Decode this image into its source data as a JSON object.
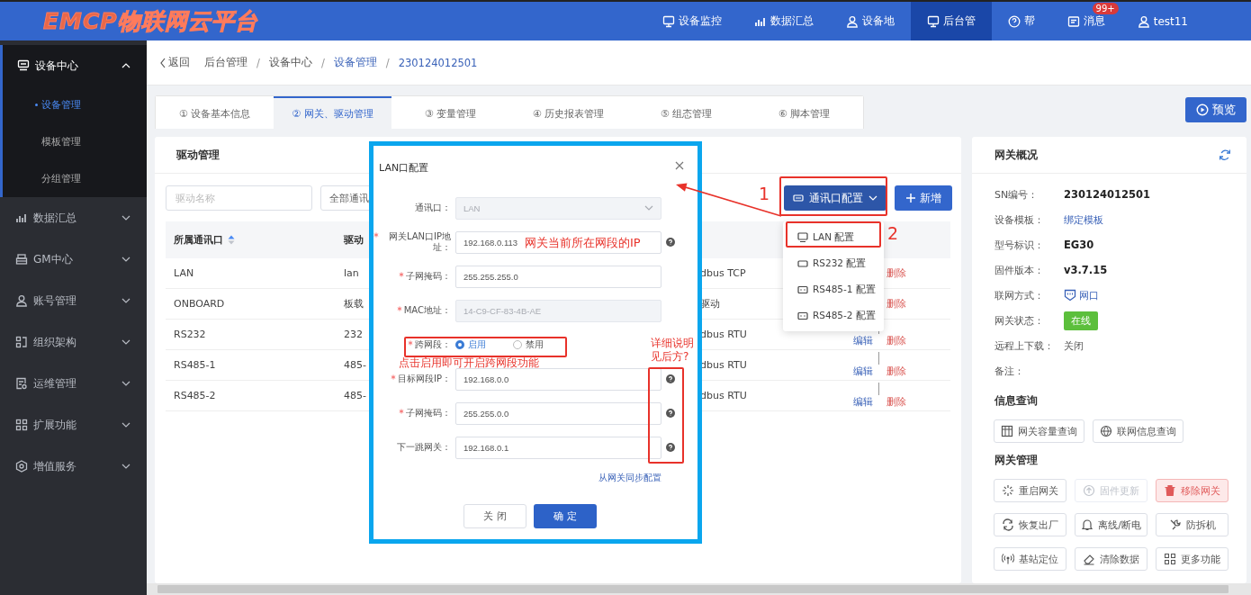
{
  "logo": "EMCP物联网云平台",
  "top_nav": [
    {
      "label": "设备监控",
      "selected": false
    },
    {
      "label": "数据汇总",
      "selected": false
    },
    {
      "label": "设备地",
      "selected": false
    },
    {
      "label": "后台管",
      "selected": true
    },
    {
      "label": "帮",
      "selected": false
    },
    {
      "label": "消息",
      "selected": false,
      "badge": "99+"
    },
    {
      "label": "test11",
      "selected": false
    }
  ],
  "sidebar": {
    "items": [
      {
        "label": "设备中心",
        "expanded": true,
        "children": [
          {
            "label": "设备管理",
            "selected": true
          },
          {
            "label": "模板管理",
            "selected": false
          },
          {
            "label": "分组管理",
            "selected": false
          }
        ]
      },
      {
        "label": "数据汇总",
        "expanded": false
      },
      {
        "label": "GM中心",
        "expanded": false
      },
      {
        "label": "账号管理",
        "expanded": false
      },
      {
        "label": "组织架构",
        "expanded": false
      },
      {
        "label": "运维管理",
        "expanded": false
      },
      {
        "label": "扩展功能",
        "expanded": false
      },
      {
        "label": "增值服务",
        "expanded": false
      }
    ]
  },
  "breadcrumb": {
    "back": "返回",
    "separator": "/",
    "items": [
      {
        "label": "后台管理",
        "link": false
      },
      {
        "label": "设备中心",
        "link": false
      },
      {
        "label": "设备管理",
        "link": true
      },
      {
        "label": "230124012501",
        "link": true
      }
    ]
  },
  "tabs": [
    {
      "label": "① 设备基本信息",
      "selected": false
    },
    {
      "label": "② 网关、驱动管理",
      "selected": true
    },
    {
      "label": "③ 变量管理",
      "selected": false
    },
    {
      "label": "④ 历史报表管理",
      "selected": false
    },
    {
      "label": "⑤ 组态管理",
      "selected": false
    },
    {
      "label": "⑥ 脚本管理",
      "selected": false
    }
  ],
  "preview_button": "预览",
  "driver_card": {
    "title": "驱动管理",
    "search": {
      "placeholder": "驱动名称"
    },
    "port_filter": "全部通讯",
    "config_button": "通讯口配置",
    "add_button": "新增",
    "config_menu": [
      "LAN 配置",
      "RS232 配置",
      "RS485-1 配置",
      "RS485-2 配置"
    ],
    "table": {
      "columns": [
        "所属通讯口",
        "驱动"
      ],
      "rows": [
        {
          "cells": [
            "LAN",
            "lan",
            "dbus TCP"
          ],
          "actions": [
            {
              "kind": "delete",
              "label": "删除"
            }
          ]
        },
        {
          "cells": [
            "ONBOARD",
            "板载",
            "驱动"
          ],
          "actions": [
            {
              "kind": "delete",
              "label": "删除"
            }
          ]
        },
        {
          "cells": [
            "RS232",
            "232",
            "dbus RTU"
          ],
          "actions": [
            {
              "kind": "edit",
              "label": "编辑"
            },
            {
              "kind": "delete",
              "label": "删除"
            }
          ]
        },
        {
          "cells": [
            "RS485-1",
            "485-",
            "dbus RTU"
          ],
          "actions": [
            {
              "kind": "edit",
              "label": "编辑"
            },
            {
              "kind": "delete",
              "label": "删除"
            }
          ]
        },
        {
          "cells": [
            "RS485-2",
            "485-",
            "dbus RTU"
          ],
          "actions": [
            {
              "kind": "edit",
              "label": "编辑"
            },
            {
              "kind": "delete",
              "label": "删除"
            }
          ]
        }
      ]
    }
  },
  "gateway_panel": {
    "title": "网关概况",
    "info": [
      {
        "label": "SN编号：",
        "value": "230124012501",
        "kind": "bold"
      },
      {
        "label": "设备模板：",
        "value": "绑定模板",
        "kind": "link"
      },
      {
        "label": "型号标识：",
        "value": "EG30",
        "kind": "bold"
      },
      {
        "label": "固件版本：",
        "value": "v3.7.15",
        "kind": "bold"
      },
      {
        "label": "联网方式：",
        "value": "网口",
        "kind": "port"
      },
      {
        "label": "网关状态：",
        "value": "在线",
        "kind": "tag"
      },
      {
        "label": "远程上下载：",
        "value": "关闭",
        "kind": "plain"
      },
      {
        "label": "备注："
      }
    ],
    "query_title": "信息查询",
    "query_buttons": [
      "网关容量查询",
      "联网信息查询"
    ],
    "manage_title": "网关管理",
    "manage_buttons": [
      {
        "label": "重启网关",
        "disabled": false,
        "danger": false
      },
      {
        "label": "固件更新",
        "disabled": true,
        "danger": false
      },
      {
        "label": "移除网关",
        "disabled": false,
        "danger": true
      },
      {
        "label": "恢复出厂",
        "disabled": false,
        "danger": false
      },
      {
        "label": "离线/断电",
        "disabled": false,
        "danger": false
      },
      {
        "label": "防拆机",
        "disabled": false,
        "danger": false
      },
      {
        "label": "基站定位",
        "disabled": false,
        "danger": false
      },
      {
        "label": "清除数据",
        "disabled": false,
        "danger": false
      },
      {
        "label": "更多功能",
        "disabled": false,
        "danger": false
      }
    ]
  },
  "lan_dialog": {
    "title": "LAN口配置",
    "fields": [
      {
        "kind": "select",
        "label": "通讯口：",
        "value": "LAN",
        "required": false,
        "disabled": true,
        "help": false
      },
      {
        "kind": "input",
        "label": "网关LAN口IP地址：",
        "value": "192.168.0.113",
        "required": true,
        "disabled": false,
        "help": true
      },
      {
        "kind": "input",
        "label": "子网掩码：",
        "value": "255.255.255.0",
        "required": true,
        "disabled": false,
        "help": false
      },
      {
        "kind": "input",
        "label": "MAC地址：",
        "value": "14-C9-CF-83-4B-AE",
        "required": true,
        "disabled": true,
        "help": false
      },
      {
        "kind": "radio",
        "label": "跨网段：",
        "required": true,
        "options": [
          {
            "label": "启用",
            "selected": true
          },
          {
            "label": "禁用",
            "selected": false
          }
        ]
      },
      {
        "kind": "input",
        "label": "目标网段IP：",
        "value": "192.168.0.0",
        "required": true,
        "disabled": false,
        "help": true
      },
      {
        "kind": "input",
        "label": "子网掩码：",
        "value": "255.255.0.0",
        "required": true,
        "disabled": false,
        "help": true
      },
      {
        "kind": "input",
        "label": "下一跳网关：",
        "value": "192.168.0.1",
        "required": false,
        "disabled": false,
        "help": true
      }
    ],
    "sync_link": "从网关同步配置",
    "cancel_button": "关 闭",
    "ok_button": "确 定"
  },
  "annotations": {
    "step_1": "1",
    "step_2": "2",
    "ip_note": "网关当前所在网段的IP",
    "cross_note": "点击启用即可开启跨网段功能",
    "help_note": "详细说明见后方?"
  }
}
